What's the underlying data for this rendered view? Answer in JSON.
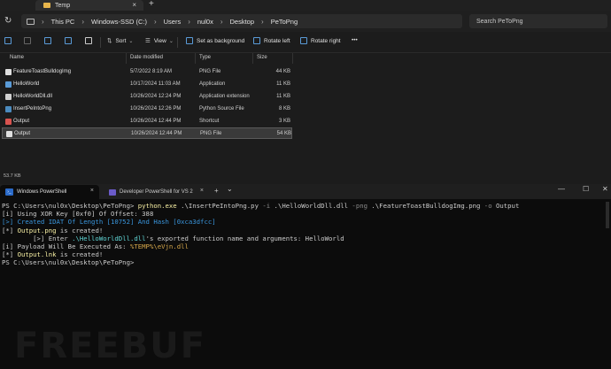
{
  "explorer": {
    "tab_title": "Temp",
    "new_tab": "+",
    "breadcrumbs": [
      "This PC",
      "Windows-SSD (C:)",
      "Users",
      "nul0x",
      "Desktop",
      "PeToPng"
    ],
    "search_placeholder": "Search PeToPng",
    "toolbar": {
      "sort": "Sort",
      "view": "View",
      "set_background": "Set as background",
      "rotate_left": "Rotate left",
      "rotate_right": "Rotate right",
      "more": "•••"
    },
    "columns": {
      "name": "Name",
      "date": "Date modified",
      "type": "Type",
      "size": "Size"
    },
    "files": [
      {
        "name": "FeatureToastBulldogImg",
        "date": "5/7/2022 8:19 AM",
        "type": "PNG File",
        "size": "44 KB",
        "icon_color": "#e0e0e0"
      },
      {
        "name": "HelloWorld",
        "date": "10/17/2024 11:03 AM",
        "type": "Application",
        "size": "11 KB",
        "icon_color": "#5a9bd8"
      },
      {
        "name": "HelloWorldDll.dll",
        "date": "10/26/2024 12:24 PM",
        "type": "Application extension",
        "size": "11 KB",
        "icon_color": "#cfcfcf"
      },
      {
        "name": "InsertPeIntoPng",
        "date": "10/26/2024 12:26 PM",
        "type": "Python Source File",
        "size": "8 KB",
        "icon_color": "#4b8bbe"
      },
      {
        "name": "Output",
        "date": "10/26/2024 12:44 PM",
        "type": "Shortcut",
        "size": "3 KB",
        "icon_color": "#d9534f"
      },
      {
        "name": "Output",
        "date": "10/26/2024 12:44 PM",
        "type": "PNG File",
        "size": "54 KB",
        "icon_color": "#e0e0e0"
      }
    ],
    "status": "53.7 KB"
  },
  "terminal": {
    "tabs": [
      {
        "label": "Windows PowerShell",
        "close": "×"
      },
      {
        "label": "Developer PowerShell for VS 2",
        "close": "×"
      }
    ],
    "new_tab": "+",
    "dropdown": "⌄",
    "window_controls": {
      "minimize": "—",
      "maximize": "☐",
      "close": "✕"
    },
    "lines": {
      "l1_prompt": "PS C:\\Users\\nul0x\\Desktop\\PeToPng> ",
      "l1_cmd": "python.exe",
      "l1_arg1": " .\\InsertPeIntoPng.py ",
      "l1_flag1": "-i",
      "l1_arg2": " .\\HelloWorldDll.dll ",
      "l1_flag2": "-png",
      "l1_arg3": " .\\FeatureToastBulldogImg.png ",
      "l1_flag3": "-o",
      "l1_arg4": " Output",
      "l2": "[i] Using XOR Key [0xf0] Of Offset: 388",
      "l3": "[>] Created IDAT Of Length [10752] And Hash [0xca3dfcc]",
      "l4_a": "[*] ",
      "l4_b": "Output.png",
      "l4_c": " is created!",
      "l5_a": "        [>] Enter ",
      "l5_b": ".\\HelloWorldDll.dll",
      "l5_c": "'s exported function name and arguments: HelloWorld",
      "l6_a": "[i] Payload Will Be Executed As: ",
      "l6_b": "%TEMP%\\eVjn.dll",
      "l7_a": "[*] ",
      "l7_b": "Output.lnk",
      "l7_c": " is created!",
      "l8": "PS C:\\Users\\nul0x\\Desktop\\PeToPng> "
    }
  },
  "watermark": "FREEBUF"
}
